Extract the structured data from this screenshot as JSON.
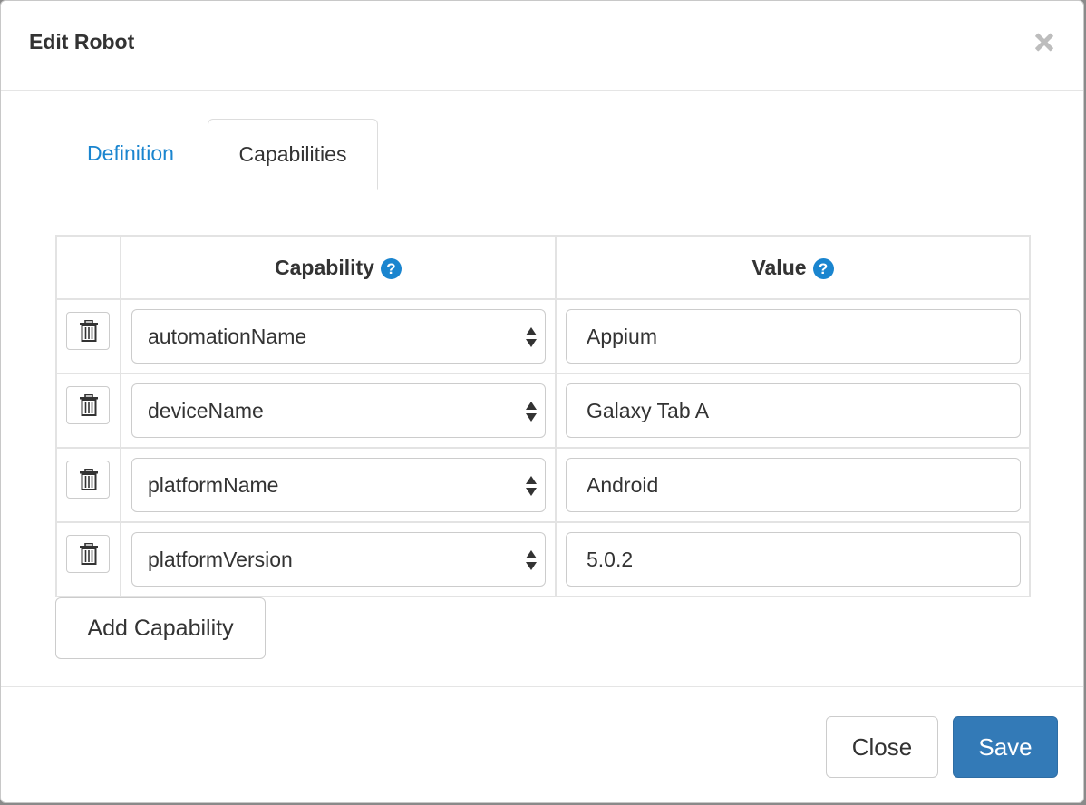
{
  "dialog": {
    "title": "Edit Robot"
  },
  "tabs": [
    {
      "label": "Definition",
      "active": false
    },
    {
      "label": "Capabilities",
      "active": true
    }
  ],
  "table": {
    "headers": {
      "capability": "Capability",
      "value": "Value"
    },
    "help_icon_glyph": "?",
    "rows": [
      {
        "capability": "automationName",
        "value": "Appium"
      },
      {
        "capability": "deviceName",
        "value": "Galaxy Tab A"
      },
      {
        "capability": "platformName",
        "value": "Android"
      },
      {
        "capability": "platformVersion",
        "value": "5.0.2"
      }
    ]
  },
  "add_button_label": "Add Capability",
  "footer": {
    "close_label": "Close",
    "save_label": "Save"
  },
  "colors": {
    "link_blue": "#1a85cf",
    "primary_button": "#337ab7"
  },
  "icons": {
    "dismiss": "close-icon",
    "help": "question-circle-icon",
    "delete": "trash-icon",
    "select": "select-arrows-icon"
  }
}
